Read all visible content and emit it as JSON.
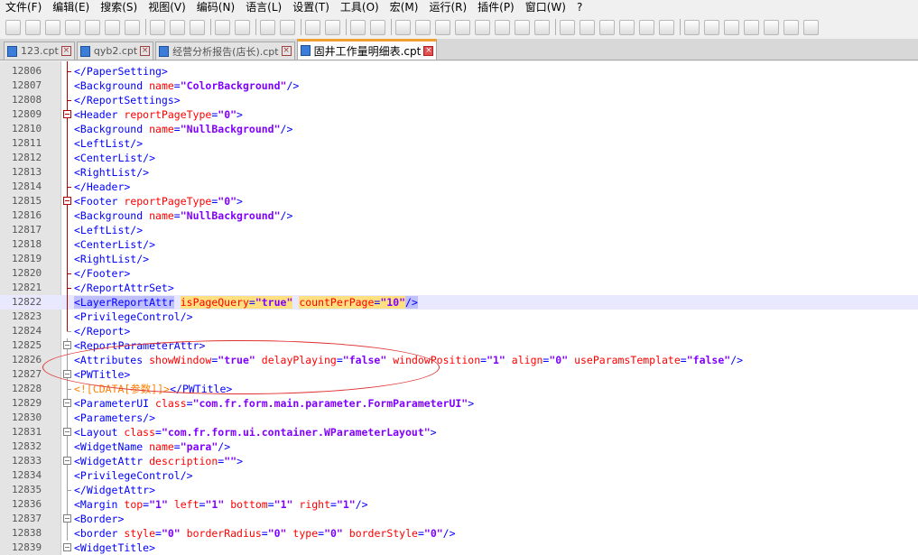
{
  "menu": [
    "文件(F)",
    "编辑(E)",
    "搜索(S)",
    "视图(V)",
    "编码(N)",
    "语言(L)",
    "设置(T)",
    "工具(O)",
    "宏(M)",
    "运行(R)",
    "插件(P)",
    "窗口(W)",
    "?"
  ],
  "toolbar_icons": [
    "new-file-icon",
    "open-file-icon",
    "save-icon",
    "save-all-icon",
    "close-icon",
    "close-all-icon",
    "print-icon",
    "cut-icon",
    "copy-icon",
    "paste-icon",
    "undo-icon",
    "redo-icon",
    "find-icon",
    "replace-icon",
    "zoom-in-icon",
    "zoom-out-icon",
    "sync-vertical-icon",
    "sync-horizontal-icon",
    "word-wrap-icon",
    "show-all-chars-icon",
    "indent-guide-icon",
    "user-lang-icon",
    "doc-map-icon",
    "function-list-icon",
    "folder-workspace-icon",
    "monitor-icon",
    "record-macro-icon",
    "stop-macro-icon",
    "play-macro-icon",
    "play-multiple-icon",
    "save-macro-icon",
    "bookmark-icon",
    "compare-icon",
    "compare-next-icon",
    "first-icon",
    "prev-icon",
    "next-icon",
    "last-icon",
    "settings-icon"
  ],
  "tabs": [
    {
      "label": "123.cpt",
      "active": false
    },
    {
      "label": "qyb2.cpt",
      "active": false
    },
    {
      "label": "经营分析报告(店长).cpt",
      "active": false
    },
    {
      "label": "固井工作量明细表.cpt",
      "active": true
    }
  ],
  "lines": [
    {
      "n": "12806",
      "t": [
        [
          "tag",
          "</PaperSetting>"
        ]
      ]
    },
    {
      "n": "12807",
      "t": [
        [
          "tag",
          "<Background "
        ],
        [
          "attr",
          "name"
        ],
        [
          "tag",
          "="
        ],
        [
          "val",
          "\"ColorBackground\""
        ],
        [
          "tag",
          "/>"
        ]
      ]
    },
    {
      "n": "12808",
      "t": [
        [
          "tag",
          "</ReportSettings>"
        ]
      ]
    },
    {
      "n": "12809",
      "t": [
        [
          "tag",
          "<Header "
        ],
        [
          "attr",
          "reportPageType"
        ],
        [
          "tag",
          "="
        ],
        [
          "val",
          "\"0\""
        ],
        [
          "tag",
          ">"
        ]
      ]
    },
    {
      "n": "12810",
      "t": [
        [
          "tag",
          "<Background "
        ],
        [
          "attr",
          "name"
        ],
        [
          "tag",
          "="
        ],
        [
          "val",
          "\"NullBackground\""
        ],
        [
          "tag",
          "/>"
        ]
      ]
    },
    {
      "n": "12811",
      "t": [
        [
          "tag",
          "<LeftList/>"
        ]
      ]
    },
    {
      "n": "12812",
      "t": [
        [
          "tag",
          "<CenterList/>"
        ]
      ]
    },
    {
      "n": "12813",
      "t": [
        [
          "tag",
          "<RightList/>"
        ]
      ]
    },
    {
      "n": "12814",
      "t": [
        [
          "tag",
          "</Header>"
        ]
      ]
    },
    {
      "n": "12815",
      "t": [
        [
          "tag",
          "<Footer "
        ],
        [
          "attr",
          "reportPageType"
        ],
        [
          "tag",
          "="
        ],
        [
          "val",
          "\"0\""
        ],
        [
          "tag",
          ">"
        ]
      ]
    },
    {
      "n": "12816",
      "t": [
        [
          "tag",
          "<Background "
        ],
        [
          "attr",
          "name"
        ],
        [
          "tag",
          "="
        ],
        [
          "val",
          "\"NullBackground\""
        ],
        [
          "tag",
          "/>"
        ]
      ]
    },
    {
      "n": "12817",
      "t": [
        [
          "tag",
          "<LeftList/>"
        ]
      ]
    },
    {
      "n": "12818",
      "t": [
        [
          "tag",
          "<CenterList/>"
        ]
      ]
    },
    {
      "n": "12819",
      "t": [
        [
          "tag",
          "<RightList/>"
        ]
      ]
    },
    {
      "n": "12820",
      "t": [
        [
          "tag",
          "</Footer>"
        ]
      ]
    },
    {
      "n": "12821",
      "t": [
        [
          "tag",
          "</ReportAttrSet>"
        ]
      ]
    },
    {
      "n": "12822",
      "t": [
        [
          "tag sel",
          "<LayerReportAttr"
        ],
        [
          "tag",
          " "
        ],
        [
          "attr hl",
          "isPageQuery"
        ],
        [
          "tag hl",
          "="
        ],
        [
          "val hl",
          "\"true\""
        ],
        [
          "tag",
          " "
        ],
        [
          "attr hl",
          "countPerPage"
        ],
        [
          "tag hl",
          "="
        ],
        [
          "val hl",
          "\"10\""
        ],
        [
          "tag sel",
          "/>"
        ]
      ]
    },
    {
      "n": "12823",
      "t": [
        [
          "tag",
          "<PrivilegeControl/>"
        ]
      ]
    },
    {
      "n": "12824",
      "t": [
        [
          "tag",
          "</Report>"
        ]
      ]
    },
    {
      "n": "12825",
      "t": [
        [
          "tag",
          "<ReportParameterAttr>"
        ]
      ]
    },
    {
      "n": "12826",
      "t": [
        [
          "tag",
          "<Attributes "
        ],
        [
          "attr",
          "showWindow"
        ],
        [
          "tag",
          "="
        ],
        [
          "val",
          "\"true\""
        ],
        [
          "tag",
          " "
        ],
        [
          "attr",
          "delayPlaying"
        ],
        [
          "tag",
          "="
        ],
        [
          "val",
          "\"false\""
        ],
        [
          "tag",
          " "
        ],
        [
          "attr",
          "windowPosition"
        ],
        [
          "tag",
          "="
        ],
        [
          "val",
          "\"1\""
        ],
        [
          "tag",
          " "
        ],
        [
          "attr",
          "align"
        ],
        [
          "tag",
          "="
        ],
        [
          "val",
          "\"0\""
        ],
        [
          "tag",
          " "
        ],
        [
          "attr",
          "useParamsTemplate"
        ],
        [
          "tag",
          "="
        ],
        [
          "val",
          "\"false\""
        ],
        [
          "tag",
          "/>"
        ]
      ]
    },
    {
      "n": "12827",
      "t": [
        [
          "tag",
          "<PWTitle>"
        ]
      ]
    },
    {
      "n": "12828",
      "t": [
        [
          "cdata",
          "<![CDATA[参数]]>"
        ],
        [
          "tag",
          "</PWTitle>"
        ]
      ]
    },
    {
      "n": "12829",
      "t": [
        [
          "tag",
          "<ParameterUI "
        ],
        [
          "attr",
          "class"
        ],
        [
          "tag",
          "="
        ],
        [
          "val",
          "\"com.fr.form.main.parameter.FormParameterUI\""
        ],
        [
          "tag",
          ">"
        ]
      ]
    },
    {
      "n": "12830",
      "t": [
        [
          "tag",
          "<Parameters/>"
        ]
      ]
    },
    {
      "n": "12831",
      "t": [
        [
          "tag",
          "<Layout "
        ],
        [
          "attr",
          "class"
        ],
        [
          "tag",
          "="
        ],
        [
          "val",
          "\"com.fr.form.ui.container.WParameterLayout\""
        ],
        [
          "tag",
          ">"
        ]
      ]
    },
    {
      "n": "12832",
      "t": [
        [
          "tag",
          "<WidgetName "
        ],
        [
          "attr",
          "name"
        ],
        [
          "tag",
          "="
        ],
        [
          "val",
          "\"para\""
        ],
        [
          "tag",
          "/>"
        ]
      ]
    },
    {
      "n": "12833",
      "t": [
        [
          "tag",
          "<WidgetAttr "
        ],
        [
          "attr",
          "description"
        ],
        [
          "tag",
          "="
        ],
        [
          "val",
          "\"\""
        ],
        [
          "tag",
          ">"
        ]
      ]
    },
    {
      "n": "12834",
      "t": [
        [
          "tag",
          "<PrivilegeControl/>"
        ]
      ]
    },
    {
      "n": "12835",
      "t": [
        [
          "tag",
          "</WidgetAttr>"
        ]
      ]
    },
    {
      "n": "12836",
      "t": [
        [
          "tag",
          "<Margin "
        ],
        [
          "attr",
          "top"
        ],
        [
          "tag",
          "="
        ],
        [
          "val",
          "\"1\""
        ],
        [
          "tag",
          " "
        ],
        [
          "attr",
          "left"
        ],
        [
          "tag",
          "="
        ],
        [
          "val",
          "\"1\""
        ],
        [
          "tag",
          " "
        ],
        [
          "attr",
          "bottom"
        ],
        [
          "tag",
          "="
        ],
        [
          "val",
          "\"1\""
        ],
        [
          "tag",
          " "
        ],
        [
          "attr",
          "right"
        ],
        [
          "tag",
          "="
        ],
        [
          "val",
          "\"1\""
        ],
        [
          "tag",
          "/>"
        ]
      ]
    },
    {
      "n": "12837",
      "t": [
        [
          "tag",
          "<Border>"
        ]
      ]
    },
    {
      "n": "12838",
      "t": [
        [
          "tag",
          "<border "
        ],
        [
          "attr",
          "style"
        ],
        [
          "tag",
          "="
        ],
        [
          "val",
          "\"0\""
        ],
        [
          "tag",
          " "
        ],
        [
          "attr",
          "borderRadius"
        ],
        [
          "tag",
          "="
        ],
        [
          "val",
          "\"0\""
        ],
        [
          "tag",
          " "
        ],
        [
          "attr",
          "type"
        ],
        [
          "tag",
          "="
        ],
        [
          "val",
          "\"0\""
        ],
        [
          "tag",
          " "
        ],
        [
          "attr",
          "borderStyle"
        ],
        [
          "tag",
          "="
        ],
        [
          "val",
          "\"0\""
        ],
        [
          "tag",
          "/>"
        ]
      ]
    },
    {
      "n": "12839",
      "t": [
        [
          "tag",
          "<WidgetTitle>"
        ]
      ]
    }
  ],
  "current_line": "12822"
}
